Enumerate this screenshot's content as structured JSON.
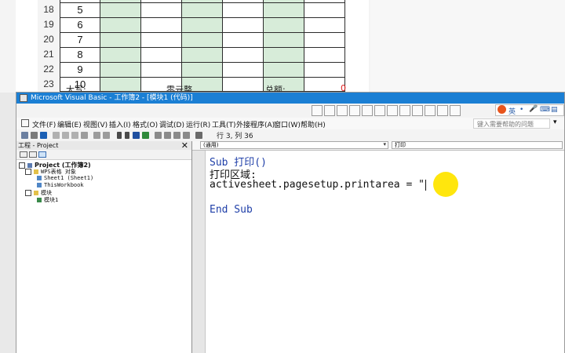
{
  "spreadsheet": {
    "rows": [
      {
        "num": "18",
        "value": "5"
      },
      {
        "num": "19",
        "value": "6"
      },
      {
        "num": "20",
        "value": "7"
      },
      {
        "num": "21",
        "value": "8"
      },
      {
        "num": "22",
        "value": "9"
      },
      {
        "num": "23",
        "value": "10"
      }
    ],
    "summary": {
      "label_big": "大写:",
      "label_mid": "零元整",
      "label_total": "总额:",
      "total_value": "0"
    },
    "colors": {
      "green": "#d7ecd9",
      "red": "#e02020"
    }
  },
  "vbe": {
    "window_title": "Microsoft Visual Basic - 工作簿2 - [模块1 (代码)]",
    "ime_label": "英",
    "menu": [
      "文件(F)",
      "编辑(E)",
      "视图(V)",
      "插入(I)",
      "格式(O)",
      "调试(D)",
      "运行(R)",
      "工具(T)",
      "外接程序(A)",
      "窗口(W)",
      "帮助(H)"
    ],
    "ask_placeholder": "键入需要帮助的问题",
    "status": "行 3, 列 36",
    "project_pane": {
      "title": "工程 - Project",
      "close": "✕",
      "nodes": [
        {
          "label": "Project (工作簿2)",
          "level": 0,
          "bold": true
        },
        {
          "label": "WPS表格 对象",
          "level": 1,
          "bold": false
        },
        {
          "label": "Sheet1 (Sheet1)",
          "level": 2,
          "bold": false
        },
        {
          "label": "ThisWorkbook",
          "level": 2,
          "bold": false
        },
        {
          "label": "模块",
          "level": 1,
          "bold": false
        },
        {
          "label": "模块1",
          "level": 2,
          "bold": false
        }
      ]
    },
    "code_pane": {
      "object_dropdown": "(通用)",
      "procedure_dropdown": "打印",
      "lines": [
        "Sub 打印()",
        "打印区域:",
        "activesheet.pagesetup.printarea = \"",
        "",
        "End Sub"
      ]
    }
  }
}
